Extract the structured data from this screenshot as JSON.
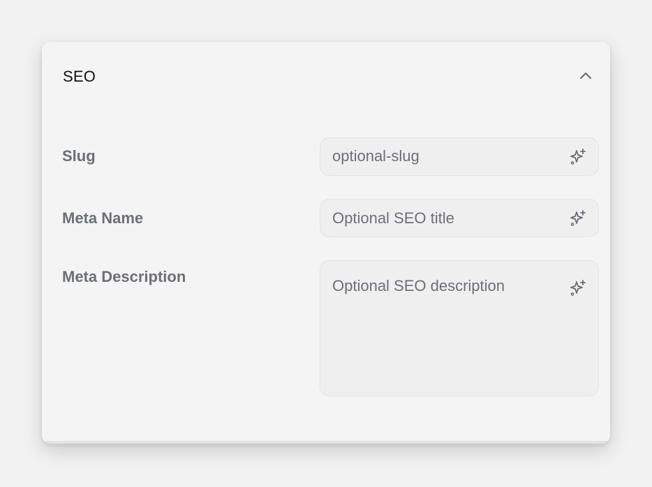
{
  "section": {
    "title": "SEO",
    "collapse_icon": "chevron-up-icon"
  },
  "fields": {
    "slug": {
      "label": "Slug",
      "value": "optional-slug",
      "icon": "sparkles-icon"
    },
    "meta_name": {
      "label": "Meta Name",
      "placeholder": "Optional SEO title",
      "icon": "sparkles-icon"
    },
    "meta_description": {
      "label": "Meta Description",
      "placeholder": "Optional SEO description",
      "icon": "sparkles-icon"
    }
  },
  "colors": {
    "page_background": "#f2f2f2",
    "card_background": "#f4f4f4",
    "field_background": "#efefef",
    "field_border": "#e2e2e2",
    "label_text": "#6d6f75",
    "title_text": "#111111"
  }
}
